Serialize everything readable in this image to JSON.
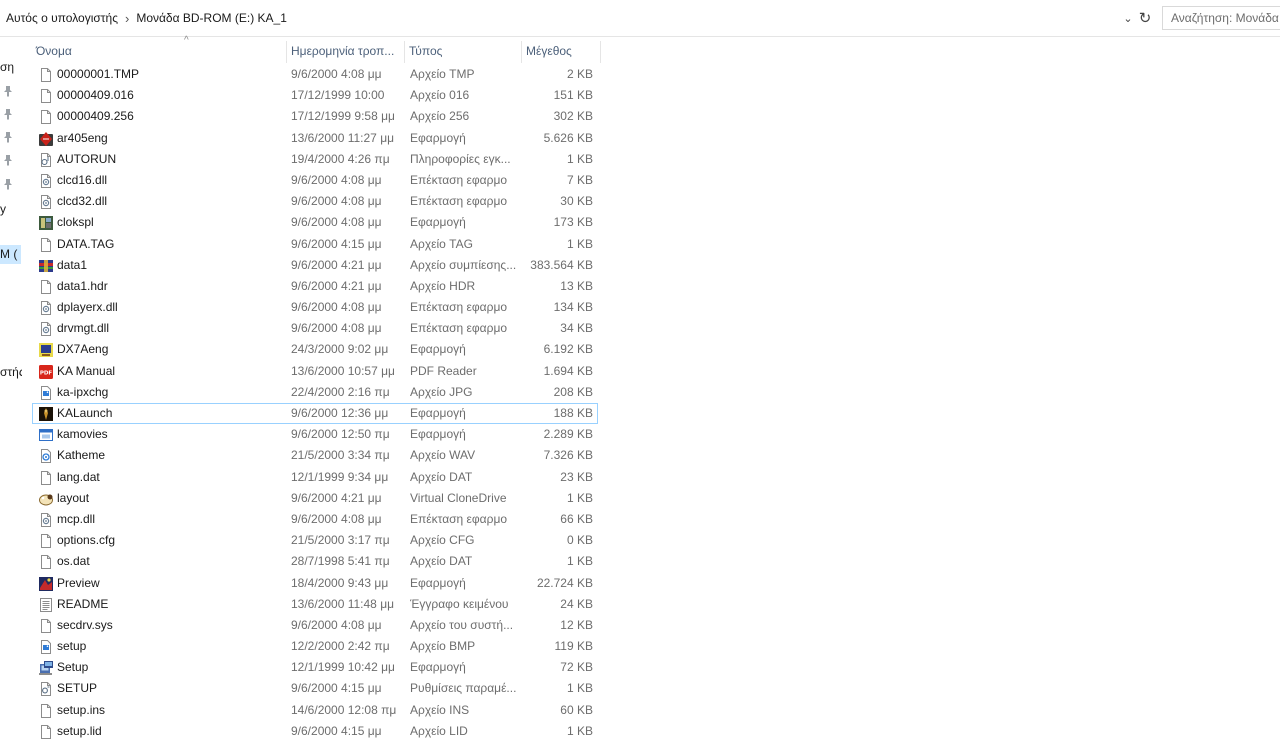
{
  "address": {
    "crumbs": [
      "Αυτός ο υπολογιστής",
      "Μονάδα BD-ROM (E:) KA_1"
    ],
    "separator": "›",
    "dropdown_glyph": "⌄",
    "refresh_glyph": "↻"
  },
  "search": {
    "placeholder": "Αναζήτηση: Μονάδα"
  },
  "navpane": {
    "fragments": [
      "ση",
      "y",
      "M (",
      "στής"
    ],
    "pinned_count": 5
  },
  "columns": {
    "sort_glyph": "^",
    "name": "Όνομα",
    "date": "Ημερομηνία τροπ...",
    "type": "Τύπος",
    "size": "Μέγεθος"
  },
  "files": [
    {
      "name": "00000001.TMP",
      "date": "9/6/2000 4:08 μμ",
      "type": "Αρχείο TMP",
      "size": "2 KB",
      "icon": "blank-file-icon"
    },
    {
      "name": "00000409.016",
      "date": "17/12/1999 10:00",
      "type": "Αρχείο 016",
      "size": "151 KB",
      "icon": "blank-file-icon"
    },
    {
      "name": "00000409.256",
      "date": "17/12/1999 9:58 μμ",
      "type": "Αρχείο 256",
      "size": "302 KB",
      "icon": "blank-file-icon"
    },
    {
      "name": "ar405eng",
      "date": "13/6/2000 11:27 μμ",
      "type": "Εφαρμογή",
      "size": "5.626 KB",
      "icon": "acrobat-installer-icon"
    },
    {
      "name": "AUTORUN",
      "date": "19/4/2000 4:26 πμ",
      "type": "Πληροφορίες εγκ...",
      "size": "1 KB",
      "icon": "setup-info-icon"
    },
    {
      "name": "clcd16.dll",
      "date": "9/6/2000 4:08 μμ",
      "type": "Επέκταση εφαρμο",
      "size": "7 KB",
      "icon": "dll-icon"
    },
    {
      "name": "clcd32.dll",
      "date": "9/6/2000 4:08 μμ",
      "type": "Επέκταση εφαρμο",
      "size": "30 KB",
      "icon": "dll-icon"
    },
    {
      "name": "clokspl",
      "date": "9/6/2000 4:08 μμ",
      "type": "Εφαρμογή",
      "size": "173 KB",
      "icon": "clokspl-app-icon"
    },
    {
      "name": "DATA.TAG",
      "date": "9/6/2000 4:15 μμ",
      "type": "Αρχείο TAG",
      "size": "1 KB",
      "icon": "blank-file-icon"
    },
    {
      "name": "data1",
      "date": "9/6/2000 4:21 μμ",
      "type": "Αρχείο συμπίεσης...",
      "size": "383.564 KB",
      "icon": "archive-icon"
    },
    {
      "name": "data1.hdr",
      "date": "9/6/2000 4:21 μμ",
      "type": "Αρχείο HDR",
      "size": "13 KB",
      "icon": "blank-file-icon"
    },
    {
      "name": "dplayerx.dll",
      "date": "9/6/2000 4:08 μμ",
      "type": "Επέκταση εφαρμο",
      "size": "134 KB",
      "icon": "dll-icon"
    },
    {
      "name": "drvmgt.dll",
      "date": "9/6/2000 4:08 μμ",
      "type": "Επέκταση εφαρμο",
      "size": "34 KB",
      "icon": "dll-icon"
    },
    {
      "name": "DX7Aeng",
      "date": "24/3/2000 9:02 μμ",
      "type": "Εφαρμογή",
      "size": "6.192 KB",
      "icon": "directx-setup-icon"
    },
    {
      "name": "KA Manual",
      "date": "13/6/2000 10:57 μμ",
      "type": "PDF Reader",
      "size": "1.694 KB",
      "icon": "pdf-icon"
    },
    {
      "name": "ka-ipxchg",
      "date": "22/4/2000 2:16 πμ",
      "type": "Αρχείο JPG",
      "size": "208 KB",
      "icon": "image-file-icon"
    },
    {
      "name": "KALaunch",
      "date": "9/6/2000 12:36 μμ",
      "type": "Εφαρμογή",
      "size": "188 KB",
      "icon": "kalaunch-app-icon",
      "focused": true
    },
    {
      "name": "kamovies",
      "date": "9/6/2000 12:50 πμ",
      "type": "Εφαρμογή",
      "size": "2.289 KB",
      "icon": "window-app-icon"
    },
    {
      "name": "Katheme",
      "date": "21/5/2000 3:34 πμ",
      "type": "Αρχείο WAV",
      "size": "7.326 KB",
      "icon": "audio-file-icon"
    },
    {
      "name": "lang.dat",
      "date": "12/1/1999 9:34 μμ",
      "type": "Αρχείο DAT",
      "size": "23 KB",
      "icon": "blank-file-icon"
    },
    {
      "name": "layout",
      "date": "9/6/2000 4:21 μμ",
      "type": "Virtual CloneDrive",
      "size": "1 KB",
      "icon": "clonedrive-sheep-icon"
    },
    {
      "name": "mcp.dll",
      "date": "9/6/2000 4:08 μμ",
      "type": "Επέκταση εφαρμο",
      "size": "66 KB",
      "icon": "dll-icon"
    },
    {
      "name": "options.cfg",
      "date": "21/5/2000 3:17 πμ",
      "type": "Αρχείο CFG",
      "size": "0 KB",
      "icon": "blank-file-icon"
    },
    {
      "name": "os.dat",
      "date": "28/7/1998 5:41 πμ",
      "type": "Αρχείο DAT",
      "size": "1 KB",
      "icon": "blank-file-icon"
    },
    {
      "name": "Preview",
      "date": "18/4/2000 9:43 μμ",
      "type": "Εφαρμογή",
      "size": "22.724 KB",
      "icon": "preview-app-icon"
    },
    {
      "name": "README",
      "date": "13/6/2000 11:48 μμ",
      "type": "Έγγραφο κειμένου",
      "size": "24 KB",
      "icon": "text-document-icon"
    },
    {
      "name": "secdrv.sys",
      "date": "9/6/2000 4:08 μμ",
      "type": "Αρχείο του συστή...",
      "size": "12 KB",
      "icon": "blank-file-icon"
    },
    {
      "name": "setup",
      "date": "12/2/2000 2:42 πμ",
      "type": "Αρχείο BMP",
      "size": "119 KB",
      "icon": "image-file-icon"
    },
    {
      "name": "Setup",
      "date": "12/1/1999 10:42 μμ",
      "type": "Εφαρμογή",
      "size": "72 KB",
      "icon": "installer-app-icon"
    },
    {
      "name": "SETUP",
      "date": "9/6/2000 4:15 μμ",
      "type": "Ρυθμίσεις παραμέ...",
      "size": "1 KB",
      "icon": "settings-file-icon"
    },
    {
      "name": "setup.ins",
      "date": "14/6/2000 12:08 πμ",
      "type": "Αρχείο INS",
      "size": "60 KB",
      "icon": "blank-file-icon"
    },
    {
      "name": "setup.lid",
      "date": "9/6/2000 4:15 μμ",
      "type": "Αρχείο LID",
      "size": "1 KB",
      "icon": "blank-file-icon"
    }
  ]
}
